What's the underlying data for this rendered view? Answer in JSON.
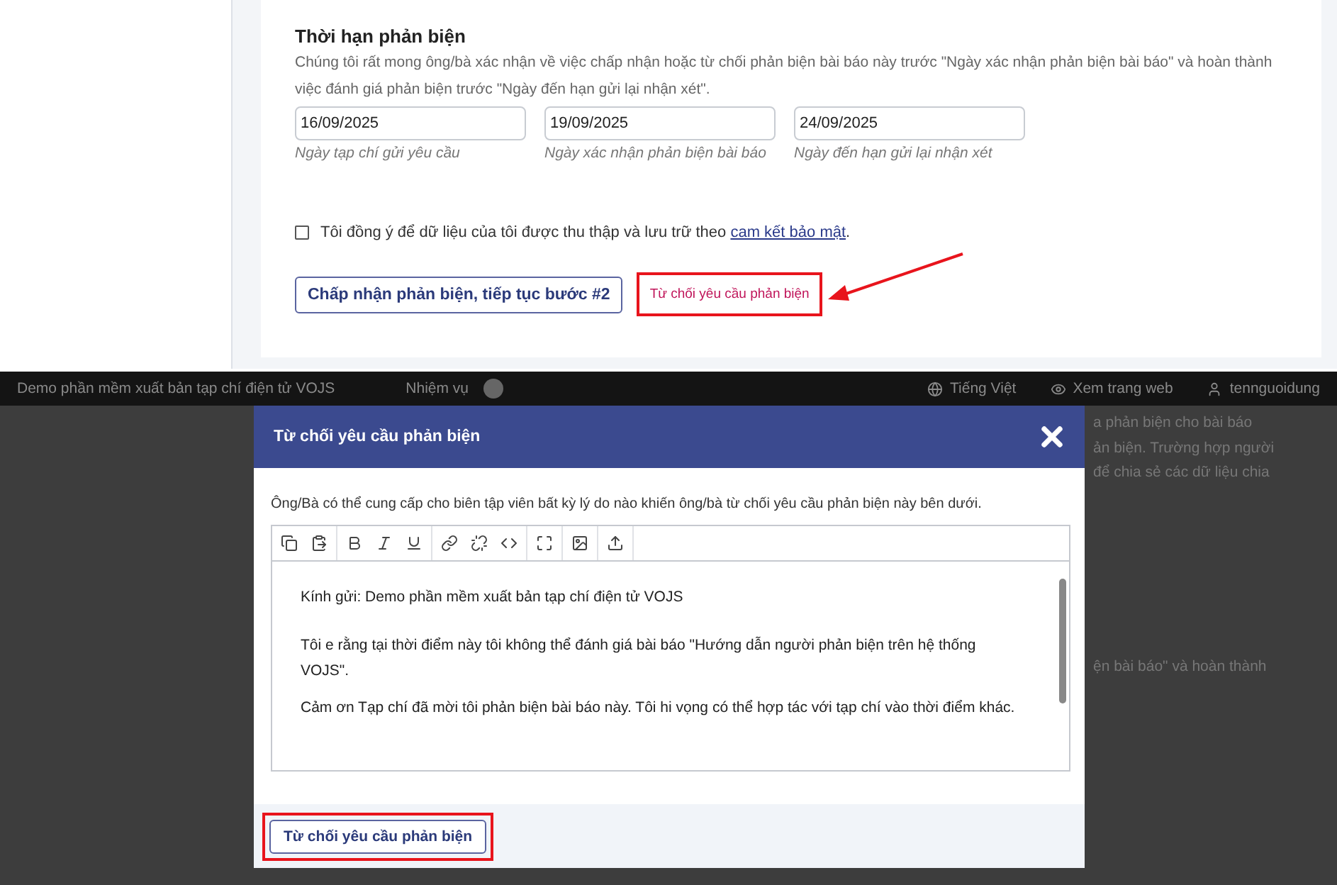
{
  "deadline_section": {
    "title": "Thời hạn phản biện",
    "description": "Chúng tôi rất mong ông/bà xác nhận về việc chấp nhận hoặc từ chối phản biện bài báo này trước \"Ngày xác nhận phản biện bài báo\" và hoàn thành việc đánh giá phản biện trước \"Ngày đến hạn gửi lại nhận xét\".",
    "dates": [
      {
        "value": "16/09/2025",
        "label": "Ngày tạp chí gửi yêu cầu"
      },
      {
        "value": "19/09/2025",
        "label": "Ngày xác nhận phản biện bài báo"
      },
      {
        "value": "24/09/2025",
        "label": "Ngày đến hạn gửi lại nhận xét"
      }
    ]
  },
  "consent": {
    "checked": false,
    "text": "Tôi đồng ý để dữ liệu của tôi được thu thập và lưu trữ theo ",
    "link": "cam kết bảo mật",
    "end": "."
  },
  "actions": {
    "accept_button": "Chấp nhận phản biện, tiếp tục bước #2",
    "decline_link": "Từ chối yêu cầu phản biện"
  },
  "background_page": {
    "site_title": "Demo phần mềm xuất bản tạp chí điện tử VOJS",
    "tasks_label": "Nhiệm vụ",
    "language": "Tiếng Việt",
    "view_site": "Xem trang web",
    "username": "tennguoidung",
    "fragments": [
      "a phản biện cho bài báo",
      "ản biện. Trường hợp người",
      "để chia sẻ các dữ liệu chia",
      "ện bài báo\" và hoàn thành"
    ]
  },
  "modal": {
    "title": "Từ chối yêu cầu phản biện",
    "instructions": "Ông/Bà có thể cung cấp cho biên tập viên bất kỳ lý do nào khiến ông/bà từ chối yêu cầu phản biện này bên dưới.",
    "editor_paragraphs": [
      "Kính gửi: Demo phần mềm xuất bản tạp chí điện tử VOJS",
      "Tôi e rằng tại thời điểm này tôi không thể đánh giá bài báo \"Hướng dẫn người phản biện trên hệ thống VOJS\".",
      "Cảm ơn Tạp chí đã mời tôi phản biện bài báo này. Tôi hi vọng có thể hợp tác với tạp chí vào thời điểm khác."
    ],
    "submit_button": "Từ chối yêu cầu phản biện"
  }
}
